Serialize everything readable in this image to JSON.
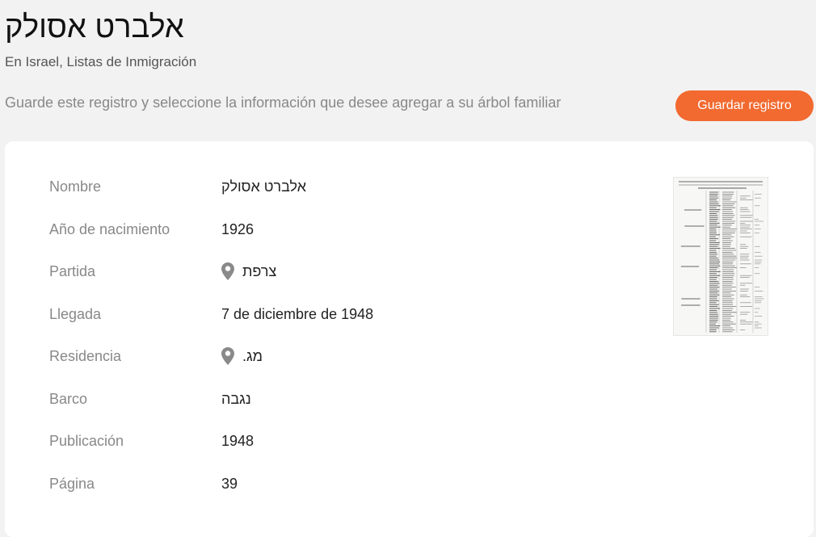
{
  "header": {
    "title": "אלברט אסולק",
    "subtitle": "En Israel, Listas de Inmigración",
    "instructions": "Guarde este registro y seleccione la información que desee agregar a su árbol familiar",
    "save_button_label": "Guardar registro"
  },
  "record": {
    "fields": [
      {
        "label": "Nombre",
        "value": "אלברט אסולק",
        "icon": null
      },
      {
        "label": "Año de nacimiento",
        "value": "1926",
        "icon": null
      },
      {
        "label": "Partida",
        "value": "צרפת",
        "icon": "location-pin-icon"
      },
      {
        "label": "Llegada",
        "value": "7 de diciembre de 1948",
        "icon": null
      },
      {
        "label": "Residencia",
        "value": "מג.",
        "icon": "location-pin-icon"
      },
      {
        "label": "Barco",
        "value": "נגבה",
        "icon": null
      },
      {
        "label": "Publicación",
        "value": "1948",
        "icon": null
      },
      {
        "label": "Página",
        "value": "39",
        "icon": null
      }
    ]
  },
  "colors": {
    "accent": "#f26a30",
    "background": "#f2f2f2",
    "card": "#ffffff",
    "label": "#888888",
    "value": "#222222",
    "icon": "#8a8a8a"
  }
}
